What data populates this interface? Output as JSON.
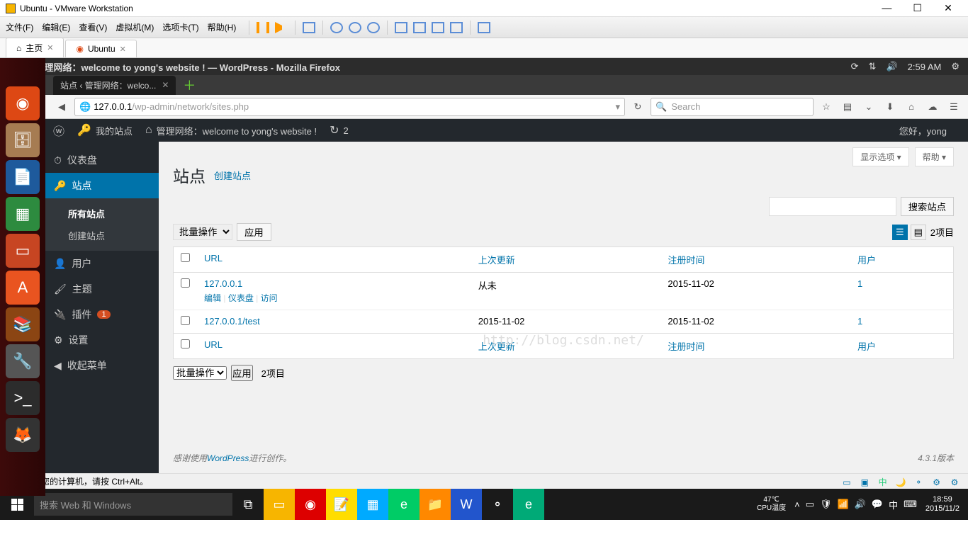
{
  "vmware": {
    "title": "Ubuntu - VMware Workstation",
    "menus": [
      "文件(F)",
      "编辑(E)",
      "查看(V)",
      "虚拟机(M)",
      "选项卡(T)",
      "帮助(H)"
    ],
    "tabs": {
      "home": "主页",
      "vm": "Ubuntu"
    },
    "status_hint": "要返回到您的计算机，请按 Ctrl+Alt。"
  },
  "ubuntu": {
    "window_title": "站点 ‹ 管理网络：welcome to yong's website ! — WordPress - Mozilla Firefox",
    "time": "2:59 AM"
  },
  "firefox": {
    "tab_title": "站点 ‹ 管理网络：welco...",
    "url_host": "127.0.0.1",
    "url_path": "/wp-admin/network/sites.php",
    "search_placeholder": "Search"
  },
  "wp": {
    "adminbar": {
      "mysites": "我的站点",
      "network": "管理网络：welcome to yong's website !",
      "updates": "2",
      "howdy": "您好，yong"
    },
    "sidebar": {
      "dashboard": "仪表盘",
      "sites": "站点",
      "all_sites": "所有站点",
      "create_site": "创建站点",
      "users": "用户",
      "themes": "主题",
      "plugins": "插件",
      "plugins_badge": "1",
      "settings": "设置",
      "collapse": "收起菜单"
    },
    "content": {
      "screen_options": "显示选项",
      "help": "帮助",
      "page_title": "站点",
      "add_new": "创建站点",
      "search_button": "搜索站点",
      "bulk_action": "批量操作",
      "apply": "应用",
      "item_count": "2项目",
      "columns": {
        "url": "URL",
        "updated": "上次更新",
        "registered": "注册时间",
        "users": "用户"
      },
      "rows": [
        {
          "url": "127.0.0.1",
          "updated": "从未",
          "registered": "2015-11-02",
          "users": "1",
          "actions": {
            "edit": "编辑",
            "dashboard": "仪表盘",
            "visit": "访问"
          }
        },
        {
          "url": "127.0.0.1/test",
          "updated": "2015-11-02",
          "registered": "2015-11-02",
          "users": "1"
        }
      ],
      "footer_thanks_pre": "感谢使用",
      "footer_thanks_link": "WordPress",
      "footer_thanks_post": "进行创作。",
      "version": "4.3.1版本",
      "watermark": "http://blog.csdn.net/"
    }
  },
  "windows": {
    "cortana": "搜索 Web 和 Windows",
    "temp": "47℃",
    "temp_label": "CPU温度",
    "time": "18:59",
    "date": "2015/11/2",
    "ime": "中"
  }
}
